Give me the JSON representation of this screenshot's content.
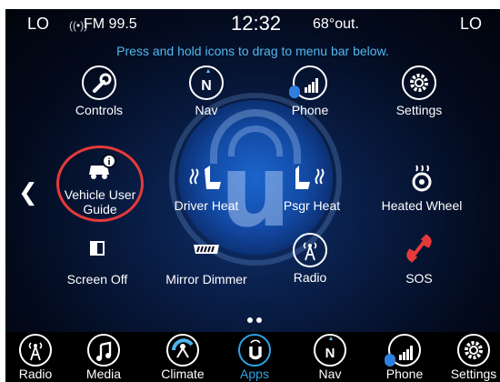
{
  "status_bar": {
    "left_mode": "LO",
    "station": "FM 99.5",
    "clock": "12:32",
    "outside_temp": "68°out.",
    "right_mode": "LO"
  },
  "hint": "Press and hold icons to drag to menu bar below.",
  "top_row": [
    {
      "label": "Controls",
      "icon": "wrench-icon"
    },
    {
      "label": "Nav",
      "icon": "compass-n-icon"
    },
    {
      "label": "Phone",
      "icon": "signal-bars-icon"
    },
    {
      "label": "Settings",
      "icon": "gear-icon"
    }
  ],
  "middle_row": [
    {
      "label_line1": "Vehicle User",
      "label_line2": "Guide",
      "icon": "vehicle-guide-icon"
    },
    {
      "label": "Driver Heat",
      "icon": "seat-heat-icon"
    },
    {
      "label": "Psgr Heat",
      "icon": "seat-heat-icon"
    },
    {
      "label": "Heated Wheel",
      "icon": "heated-wheel-icon"
    }
  ],
  "lower_row": [
    {
      "label": "Screen Off",
      "icon": "screen-off-icon"
    },
    {
      "label": "Mirror Dimmer",
      "icon": "mirror-dimmer-icon"
    },
    {
      "label": "Radio",
      "icon": "radio-tower-icon"
    },
    {
      "label": "SOS",
      "icon": "phone-handset-icon"
    }
  ],
  "bottom_bar": [
    {
      "label": "Radio",
      "icon": "radio-tower-icon"
    },
    {
      "label": "Media",
      "icon": "music-note-icon"
    },
    {
      "label": "Climate",
      "icon": "climate-icon"
    },
    {
      "label": "Apps",
      "icon": "uconnect-icon",
      "active": true
    },
    {
      "label": "Nav",
      "icon": "compass-n-icon"
    },
    {
      "label": "Phone",
      "icon": "signal-bars-icon"
    },
    {
      "label": "Settings",
      "icon": "gear-icon"
    }
  ],
  "colors": {
    "accent": "#2fa3e6",
    "hint": "#52b7ee",
    "sos_red": "#e63a3a",
    "highlight_ring": "#e63a3a"
  },
  "compass_letter": "N",
  "watermark_letter": "u"
}
